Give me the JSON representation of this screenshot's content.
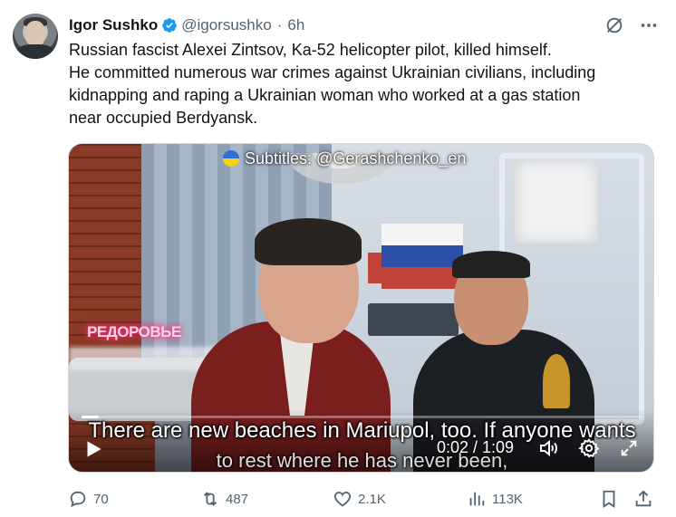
{
  "author": {
    "name": "Igor Sushko",
    "handle": "@igorsushko",
    "separator": "·",
    "time": "6h",
    "verified": true
  },
  "icons": {
    "grok": "slash-circle-icon",
    "more": "more-horizontal-icon",
    "verified": "verified-badge-icon",
    "reply": "reply-icon",
    "retweet": "retweet-icon",
    "like": "heart-icon",
    "views": "views-icon",
    "bookmark": "bookmark-icon",
    "share": "share-icon"
  },
  "tweet": {
    "lines": [
      "Russian fascist Alexei Zintsov, Ka-52 helicopter pilot, killed himself.",
      "He committed numerous war crimes against Ukrainian civilians, including",
      "kidnapping and raping a Ukrainian woman who worked at a gas station",
      "near occupied Berdyansk."
    ]
  },
  "video": {
    "watermark": "Subtitles: @Gerashchenko_en",
    "neon_sign": "РЕДОРОВЬЕ",
    "subtitle_line1": "There are new beaches in Mariupol, too. If anyone wants",
    "subtitle_line2": "to rest where he has never been,",
    "timecode": "0:02 / 1:09",
    "progress_fraction": 0.03
  },
  "actions": {
    "replies": "70",
    "retweets": "487",
    "likes": "2.1K",
    "views": "113K"
  },
  "colors": {
    "text": "#0f1419",
    "secondary": "#536471",
    "verified": "#1d9bf0"
  }
}
